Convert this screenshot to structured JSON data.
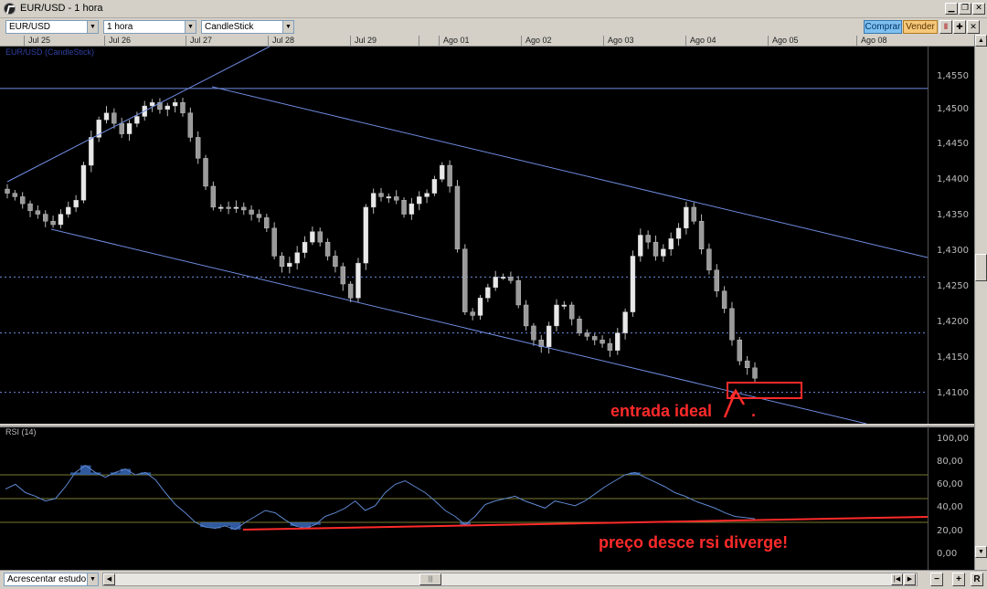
{
  "window": {
    "title": "EUR/USD - 1 hora"
  },
  "toolbar": {
    "symbol": "EUR/USD",
    "interval": "1 hora",
    "chart_type": "CandleStick",
    "buy_label": "Comprar",
    "sell_label": "Vender"
  },
  "time_axis": [
    "Jul 25",
    "Jul 26",
    "Jul 27",
    "Jul 28",
    "Jul 29",
    "",
    "Ago 01",
    "Ago 02",
    "Ago 03",
    "Ago 04",
    "Ago 05",
    "Ago 08"
  ],
  "price_pane": {
    "title": "EUR/USD (CandleStick)"
  },
  "rsi_pane": {
    "title": "RSI (14)"
  },
  "annotations": {
    "entry": "entrada ideal",
    "dot": ".",
    "divergence": "preço desce rsi diverge!"
  },
  "bottom": {
    "study_select": "Acrescentar estudo",
    "reset_label": "R"
  },
  "colors": {
    "candle_up": "#e8e8e8",
    "candle_down": "#9a9a9a",
    "channel": "#6f8be0",
    "annotation": "#ff2a2a",
    "rsi_line": "#5e88d0",
    "rsi_fill": "#3868b8"
  },
  "chart_data": [
    {
      "type": "candlestick",
      "title": "EUR/USD (CandleStick)",
      "x": [
        "Jul 25",
        "Jul 26",
        "Jul 27",
        "Jul 28",
        "Jul 29",
        "Ago 01",
        "Ago 02",
        "Ago 03",
        "Ago 04",
        "Ago 05"
      ],
      "y_ticks": [
        "1,4550",
        "1,4500",
        "1,4450",
        "1,4400",
        "1,4350",
        "1,4300",
        "1,4250",
        "1,4200",
        "1,4150",
        "1,4100"
      ],
      "ylim": [
        1.406,
        1.46
      ],
      "close_path": [
        1.439,
        1.4385,
        1.4375,
        1.4365,
        1.436,
        1.435,
        1.4345,
        1.436,
        1.437,
        1.438,
        1.443,
        1.447,
        1.4495,
        1.4505,
        1.449,
        1.4475,
        1.449,
        1.45,
        1.4515,
        1.452,
        1.451,
        1.4515,
        1.452,
        1.4505,
        1.447,
        1.444,
        1.44,
        1.437,
        1.437,
        1.4368,
        1.437,
        1.4366,
        1.436,
        1.4355,
        1.434,
        1.43,
        1.4285,
        1.429,
        1.4305,
        1.432,
        1.4335,
        1.432,
        1.43,
        1.4285,
        1.426,
        1.424,
        1.429,
        1.437,
        1.439,
        1.4385,
        1.4385,
        1.438,
        1.436,
        1.4375,
        1.4385,
        1.439,
        1.441,
        1.443,
        1.44,
        1.431,
        1.422,
        1.4215,
        1.424,
        1.4255,
        1.427,
        1.427,
        1.4265,
        1.423,
        1.42,
        1.418,
        1.417,
        1.42,
        1.423,
        1.423,
        1.421,
        1.419,
        1.4185,
        1.418,
        1.4175,
        1.4165,
        1.419,
        1.422,
        1.43,
        1.433,
        1.432,
        1.43,
        1.431,
        1.4325,
        1.434,
        1.437,
        1.435,
        1.431,
        1.428,
        1.425,
        1.4225,
        1.418,
        1.415,
        1.414,
        1.4125
      ],
      "channel": {
        "upper_line": [
          [
            "Jul 26",
            1.4535
          ],
          [
            "Ago 05+",
            1.429
          ]
        ],
        "lower_line": [
          [
            "Jul 25",
            1.433
          ],
          [
            "Ago 05+",
            1.4048
          ]
        ],
        "rising_line": [
          [
            "Jul 25",
            1.44
          ],
          [
            "Jul 28",
            1.46
          ]
        ],
        "horizontal_levels": [
          1.454,
          1.427,
          1.419,
          1.4105
        ]
      }
    },
    {
      "type": "line",
      "title": "RSI (14)",
      "y_ticks": [
        "100,00",
        "80,00",
        "60,00",
        "40,00",
        "20,00",
        "0,00"
      ],
      "ylim": [
        -10,
        110
      ],
      "levels": [
        70,
        50,
        30
      ],
      "values": [
        58,
        62,
        55,
        52,
        48,
        50,
        60,
        72,
        78,
        72,
        68,
        72,
        75,
        70,
        72,
        66,
        55,
        45,
        38,
        30,
        26,
        25,
        27,
        24,
        30,
        35,
        40,
        38,
        32,
        27,
        25,
        28,
        35,
        38,
        42,
        48,
        40,
        44,
        55,
        62,
        65,
        60,
        55,
        48,
        40,
        35,
        28,
        35,
        45,
        48,
        50,
        52,
        48,
        45,
        42,
        48,
        46,
        44,
        48,
        54,
        60,
        65,
        70,
        72,
        68,
        64,
        60,
        55,
        52,
        48,
        45,
        42,
        38,
        35,
        34,
        33
      ],
      "divergence_line": [
        [
          0,
          23
        ],
        [
          1,
          33
        ]
      ]
    }
  ]
}
